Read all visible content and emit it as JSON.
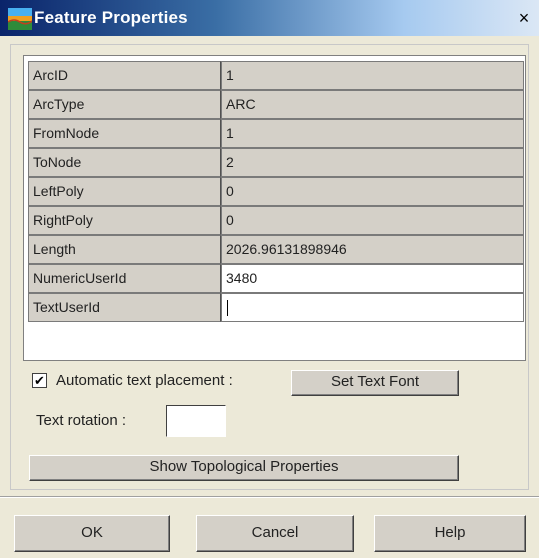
{
  "window": {
    "title": "Feature Properties",
    "close_symbol": "×",
    "icon": "app-icon"
  },
  "properties": [
    {
      "name": "ArcID",
      "value": "1",
      "editable": false
    },
    {
      "name": "ArcType",
      "value": "ARC",
      "editable": false
    },
    {
      "name": "FromNode",
      "value": "1",
      "editable": false
    },
    {
      "name": "ToNode",
      "value": "2",
      "editable": false
    },
    {
      "name": "LeftPoly",
      "value": "0",
      "editable": false
    },
    {
      "name": "RightPoly",
      "value": "0",
      "editable": false
    },
    {
      "name": "Length",
      "value": "2026.96131898946",
      "editable": false
    },
    {
      "name": "NumericUserId",
      "value": "3480",
      "editable": true
    },
    {
      "name": "TextUserId",
      "value": "",
      "editable": true
    }
  ],
  "options": {
    "auto_text_label": "Automatic text placement :",
    "auto_text_checked": true,
    "check_mark": "✔",
    "set_font_label": "Set Text Font",
    "rotation_label": "Text rotation :",
    "rotation_value": "",
    "show_topo_label": "Show Topological Properties"
  },
  "footer": {
    "ok_label": "OK",
    "cancel_label": "Cancel",
    "help_label": "Help"
  },
  "colors": {
    "dialog_bg": "#ece9d8",
    "readonly_cell": "#d4d0c8",
    "editable_cell": "#ffffff",
    "title_gradient_start": "#0a246a"
  }
}
